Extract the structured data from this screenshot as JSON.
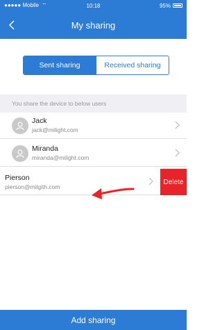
{
  "status_bar": {
    "carrier": "●●●●● Mobile",
    "time": "10:18",
    "battery": "95%"
  },
  "header": {
    "title": "My sharing",
    "back_icon": "chevron-left-icon"
  },
  "tabs": [
    {
      "label": "Sent sharing",
      "active": true
    },
    {
      "label": "Received sharing",
      "active": false
    }
  ],
  "section_header": "You share the device to below users",
  "users": [
    {
      "name": "Jack",
      "email": "jack@milight.com"
    },
    {
      "name": "Miranda",
      "email": "miranda@milight.com"
    },
    {
      "name": "Pierson",
      "email": "pierson@milgith.com",
      "delete_label": "Delete"
    }
  ],
  "add_button": "Add sharing",
  "colors": {
    "primary": "#2c7bd4",
    "delete": "#e8242a",
    "arrow": "#e8242a"
  }
}
